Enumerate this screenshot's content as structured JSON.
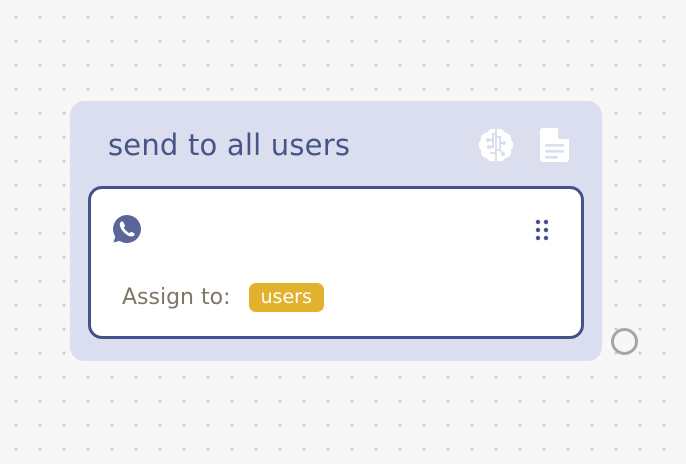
{
  "node": {
    "title": "send to all users",
    "icons": [
      "brain-icon",
      "document-icon"
    ],
    "channel_icon": "whatsapp-icon",
    "assign_label": "Assign to:",
    "assign_tag": "users"
  },
  "colors": {
    "node_bg": "#dadeee",
    "accent": "#45518a",
    "tag": "#e2b12d",
    "label": "#7d7766"
  }
}
